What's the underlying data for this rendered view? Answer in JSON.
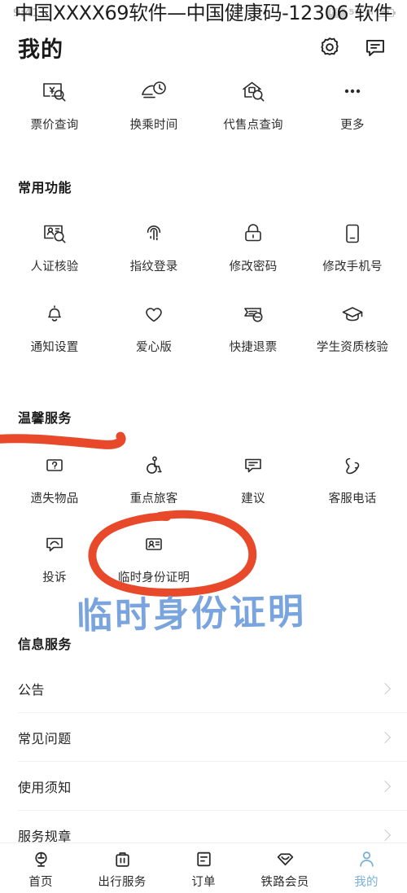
{
  "overlay": {
    "watermark_title": "中国XXXX69软件—中国健康码-12306 软件",
    "handwritten_note": "临时身份证明",
    "note_color": "#7aa4de",
    "marker_color": "#e8492a"
  },
  "statusbar": {
    "time": "9:41",
    "badges": [
      "HD",
      "5G"
    ],
    "signal": "ıll",
    "battery": "87"
  },
  "header": {
    "title": "我的",
    "actions": [
      {
        "name": "settings",
        "icon": "gear-icon"
      },
      {
        "name": "messages",
        "icon": "message-icon"
      }
    ]
  },
  "quick_row": {
    "items": [
      {
        "label": "票价查询",
        "icon": "fare-search-icon"
      },
      {
        "label": "换乘时间",
        "icon": "transfer-time-icon"
      },
      {
        "label": "代售点查询",
        "icon": "agency-search-icon"
      },
      {
        "label": "更多",
        "icon": "more-dots-icon"
      }
    ]
  },
  "common_functions": {
    "title": "常用功能",
    "items": [
      {
        "label": "人证核验",
        "icon": "id-verify-icon"
      },
      {
        "label": "指纹登录",
        "icon": "fingerprint-icon"
      },
      {
        "label": "修改密码",
        "icon": "lock-icon"
      },
      {
        "label": "修改手机号",
        "icon": "phone-icon"
      },
      {
        "label": "通知设置",
        "icon": "bell-icon"
      },
      {
        "label": "爱心版",
        "icon": "heart-icon"
      },
      {
        "label": "快捷退票",
        "icon": "refund-ticket-icon"
      },
      {
        "label": "学生资质核验",
        "icon": "graduation-cap-icon"
      }
    ]
  },
  "warm_services": {
    "title": "温馨服务",
    "items": [
      {
        "label": "遗失物品",
        "icon": "lost-item-icon"
      },
      {
        "label": "重点旅客",
        "icon": "wheelchair-icon"
      },
      {
        "label": "建议",
        "icon": "suggestion-icon"
      },
      {
        "label": "客服电话",
        "icon": "phone-call-icon"
      },
      {
        "label": "投诉",
        "icon": "complaint-icon"
      },
      {
        "label": "临时身份证明",
        "icon": "temp-id-icon"
      }
    ]
  },
  "info_services": {
    "title": "信息服务",
    "rows": [
      {
        "label": "公告"
      },
      {
        "label": "常见问题"
      },
      {
        "label": "使用须知"
      },
      {
        "label": "服务规章"
      }
    ]
  },
  "tabbar": {
    "active_color": "#79b0d8",
    "tabs": [
      {
        "label": "首页",
        "icon": "home-rail-icon",
        "active": false
      },
      {
        "label": "出行服务",
        "icon": "suitcase-icon",
        "active": false
      },
      {
        "label": "订单",
        "icon": "order-list-icon",
        "active": false
      },
      {
        "label": "铁路会员",
        "icon": "member-diamond-icon",
        "active": false
      },
      {
        "label": "我的",
        "icon": "person-icon",
        "active": true
      }
    ]
  }
}
